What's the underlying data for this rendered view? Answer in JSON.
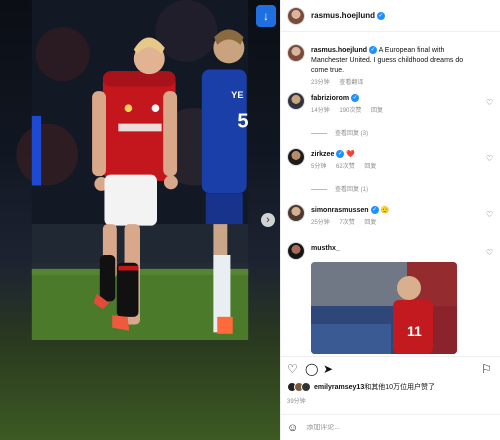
{
  "media": {
    "download_icon": "download-icon",
    "next_icon": "chevron-right-icon"
  },
  "header": {
    "username": "rasmus.hoejlund"
  },
  "caption": {
    "username": "rasmus.hoejlund",
    "text": "A European final with Manchester United. I guess childhood dreams do come true.",
    "time": "23分钟",
    "translate": "查看翻译"
  },
  "comments": [
    {
      "username": "fabriziorom",
      "text": "",
      "time": "14分钟",
      "likes": "190次赞",
      "reply": "回复",
      "view_replies": "查看回复 (3)"
    },
    {
      "username": "zirkzee",
      "text": "❤️",
      "time": "5分钟",
      "likes": "62次赞",
      "reply": "回复",
      "view_replies": "查看回复 (1)"
    },
    {
      "username": "simonrasmussen",
      "text": "🫡",
      "time": "25分钟",
      "likes": "7次赞",
      "reply": "回复"
    },
    {
      "username": "musthx_",
      "text": ""
    }
  ],
  "likes": {
    "text": "emilyramsey13和其他10万位用户赞了",
    "username": "emilyramsey13",
    "rest": "和其他10万位用户赞了"
  },
  "post_time": "39分钟",
  "add_comment": {
    "placeholder": "添加评论..."
  },
  "colors": {
    "verified": "#1e90ff",
    "heart": "#e0245e"
  }
}
